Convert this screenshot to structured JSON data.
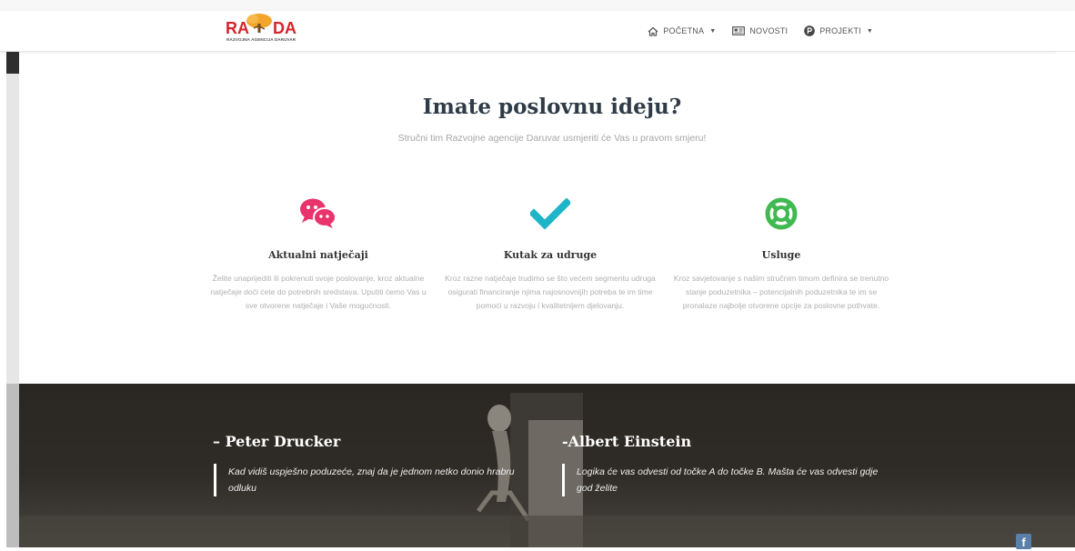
{
  "brand": {
    "logo_left": "RA",
    "logo_right": "DA",
    "logo_subtitle": "RAZVOJNA AGENCIJA DARUVAR",
    "colors": {
      "red": "#d8232a",
      "orange": "#f3a52b"
    }
  },
  "nav": {
    "items": [
      {
        "label": "POČETNA",
        "icon": "home-icon",
        "has_dropdown": true
      },
      {
        "label": "NOVOSTI",
        "icon": "newspaper-icon",
        "has_dropdown": false
      },
      {
        "label": "PROJEKTI",
        "icon": "p-circle-icon",
        "has_dropdown": true
      }
    ]
  },
  "hero": {
    "title": "Imate poslovnu ideju?",
    "subtitle": "Stručni tim Razvojne agencije Daruvar usmjeriti će Vas u pravom smjeru!"
  },
  "features": [
    {
      "icon": "chat-bubbles-icon",
      "icon_color": "#e8336d",
      "title": "Aktualni natječaji",
      "text": "Želite unaprijediti ili pokrenuti svoje poslovanje, kroz aktualne natječaje doći ćete do potrebnih sredstava. Uputiti ćemo Vas u sve otvorene natječaje i Vaše mogućnosti."
    },
    {
      "icon": "checkmark-icon",
      "icon_color": "#1fb5c9",
      "title": "Kutak za udruge",
      "text": "Kroz razne natječaje trudimo se što većem segmentu udruga osigurati financiranje njima najosnovnijih potreba te im time pomoći u razvoju i kvalitetnijem djelovanju."
    },
    {
      "icon": "lifebuoy-icon",
      "icon_color": "#3fb950",
      "title": "Usluge",
      "text": "Kroz savjetovanje s našim stručnim timom definira se trenutno stanje poduzetnika – potencijalnih poduzetnika te im se pronalaze najbolje otvorene opcije za poslovne pothvate."
    }
  ],
  "quotes": [
    {
      "author": "– Peter Drucker",
      "text": "Kad vidiš uspješno poduzeće, znaj da je jednom netko donio hrabru odluku"
    },
    {
      "author": "-Albert Einstein",
      "text": "Logika će vas odvesti od točke A do točke B. Mašta će vas odvesti gdje god želite"
    }
  ],
  "social": {
    "facebook_glyph": "f"
  }
}
